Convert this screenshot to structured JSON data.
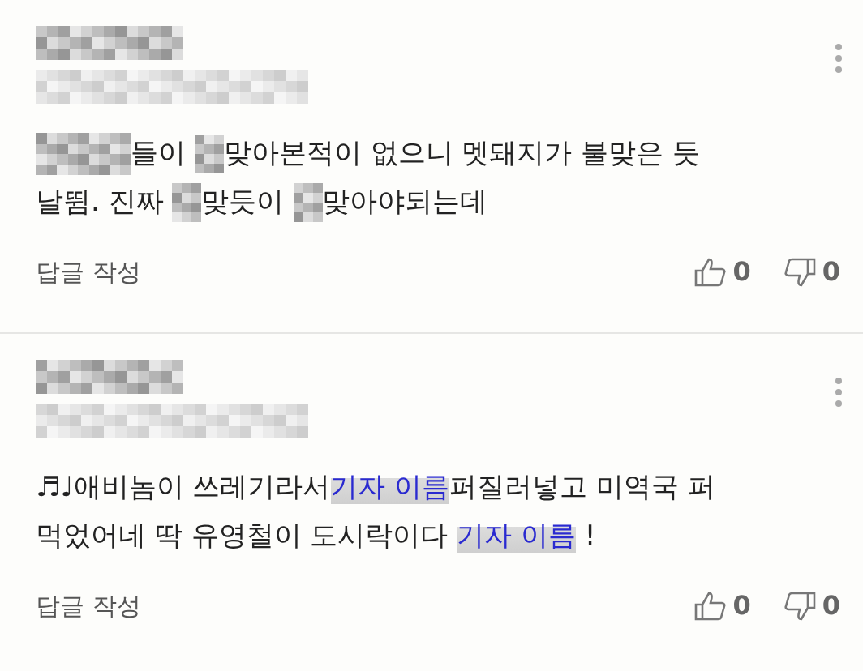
{
  "comments": [
    {
      "lines": [
        [
          {
            "kind": "mosaic"
          },
          {
            "kind": "text",
            "text": "들이 "
          },
          {
            "kind": "blot"
          },
          {
            "kind": "text",
            "text": "맞아본적이 없으니 멧돼지가 불맞은 듯"
          }
        ],
        [
          {
            "kind": "text",
            "text": "날뜀. 진짜 "
          },
          {
            "kind": "blot"
          },
          {
            "kind": "text",
            "text": "맞듯이 "
          },
          {
            "kind": "blot"
          },
          {
            "kind": "text",
            "text": "맞아야되는데"
          }
        ]
      ],
      "reply": "답글 작성",
      "likes": "0",
      "dislikes": "0"
    },
    {
      "lines": [
        [
          {
            "kind": "text",
            "text": "♬♩애비놈이 쓰레기라서"
          },
          {
            "kind": "highlight",
            "text": "기자 이름"
          },
          {
            "kind": "text",
            "text": "퍼질러넣고 미역국 퍼"
          }
        ],
        [
          {
            "kind": "text",
            "text": "먹었어네 딱 유영철이 도시락이다 "
          },
          {
            "kind": "highlight",
            "text": "기자 이름"
          },
          {
            "kind": "text",
            "text": " !"
          }
        ]
      ],
      "reply": "답글 작성",
      "likes": "0",
      "dislikes": "0"
    }
  ]
}
